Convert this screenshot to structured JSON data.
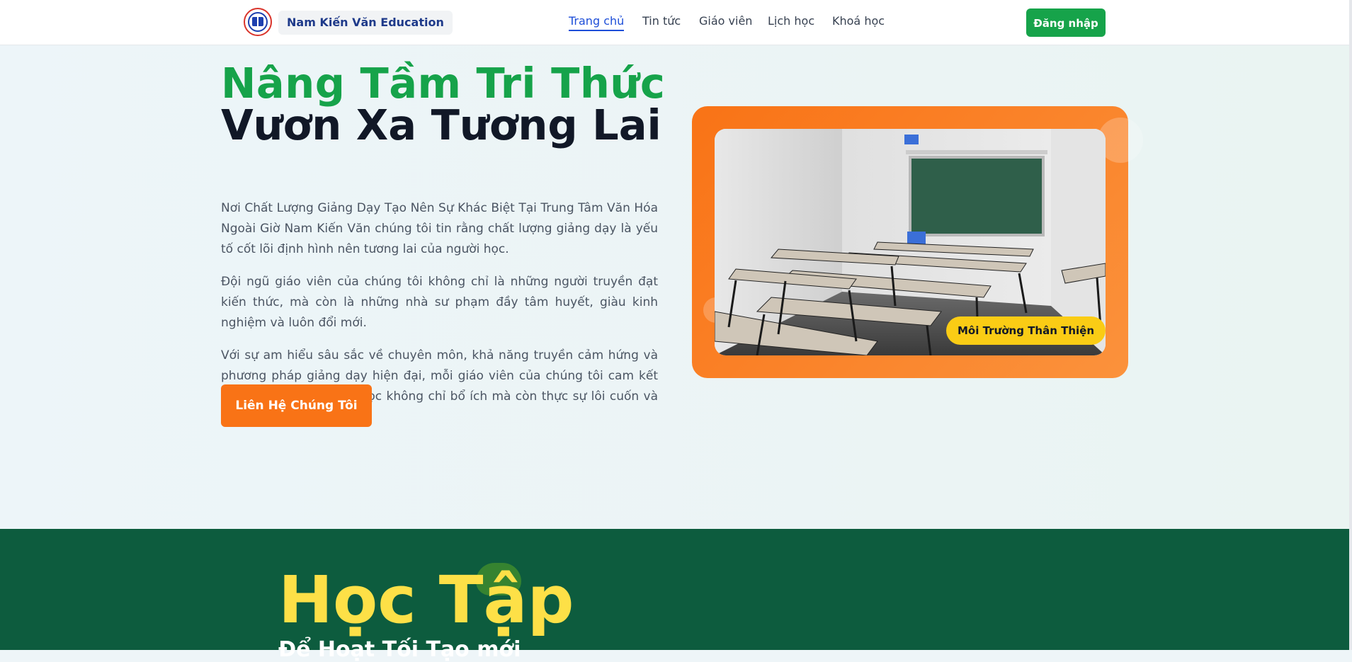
{
  "header": {
    "brand": "Nam Kiến Văn Education",
    "nav": [
      "Trang chủ",
      "Tin tức",
      "Giáo viên",
      "Lịch học",
      "Khoá học"
    ],
    "active_nav": "Trang chủ",
    "login_label": "Đăng nhập"
  },
  "hero": {
    "title_line1": "Nâng Tầm Tri Thức",
    "title_line2": "Vươn Xa Tương Lai",
    "paragraphs": [
      "Nơi Chất Lượng Giảng Dạy Tạo Nên Sự Khác Biệt Tại Trung Tâm Văn Hóa Ngoài Giờ Nam Kiến Văn chúng tôi tin rằng chất lượng giảng dạy là yếu tố cốt lõi định hình nên tương lai của người học.",
      "Đội ngũ giáo viên của chúng tôi không chỉ là những người truyền đạt kiến thức, mà còn là những nhà sư phạm đầy tâm huyết, giàu kinh nghiệm và luôn đổi mới.",
      "Với sự am hiểu sâu sắc về chuyên môn, khả năng truyền cảm hứng và phương pháp giảng dạy hiện đại, mỗi giáo viên của chúng tôi cam kết mang đến những buổi học không chỉ bổ ích mà còn thực sự lôi cuốn và tương tác."
    ],
    "cta_label": "Liên Hệ Chúng Tôi",
    "image_badge": "Môi Trường Thân Thiện"
  },
  "section2": {
    "title": "Học Tập",
    "subtitle": "Để Hoạt Tối Tạo mới"
  },
  "colors": {
    "primary_green": "#16a34a",
    "accent_orange": "#f97316",
    "badge_yellow": "#facc15",
    "dark_green": "#0d5c3e",
    "nav_active": "#1d4ed8"
  }
}
